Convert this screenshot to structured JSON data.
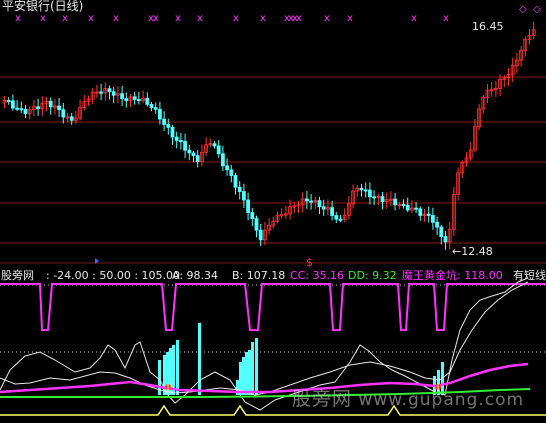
{
  "window": {
    "title": "平安银行(日线)"
  },
  "price_labels": {
    "high": "16.45",
    "low": "12.48"
  },
  "markers": {
    "top_marks": "x",
    "ref_marks": "◇",
    "signal_mark": "$"
  },
  "indicator_bar": {
    "name": "股旁网",
    "params": ": -24.00 : 50.00 : 105.00",
    "a_label": "A: 98.34",
    "b_label": "B: 107.18",
    "cc_label": "CC: 35.16",
    "dd_label": "DD: 9.32",
    "gold_label": "魔王黄金坑: 118.00",
    "tail_label": "有短线"
  },
  "watermark": {
    "main": "股旁网",
    "url": "www.gupang.com"
  },
  "colors": {
    "up": "#ff3333",
    "down": "#54ffff",
    "grid": "#8b1a1a",
    "magenta": "#ff33ff",
    "white": "#e8e8e8",
    "green": "#33ee33",
    "yellow": "#ffff66",
    "label_a": "#e8e8e8",
    "label_b": "#e8e8e8",
    "label_cc": "#ff33ff",
    "label_dd": "#33ee33",
    "label_gold": "#ff33ff",
    "label_name": "#e8e8e8"
  }
}
